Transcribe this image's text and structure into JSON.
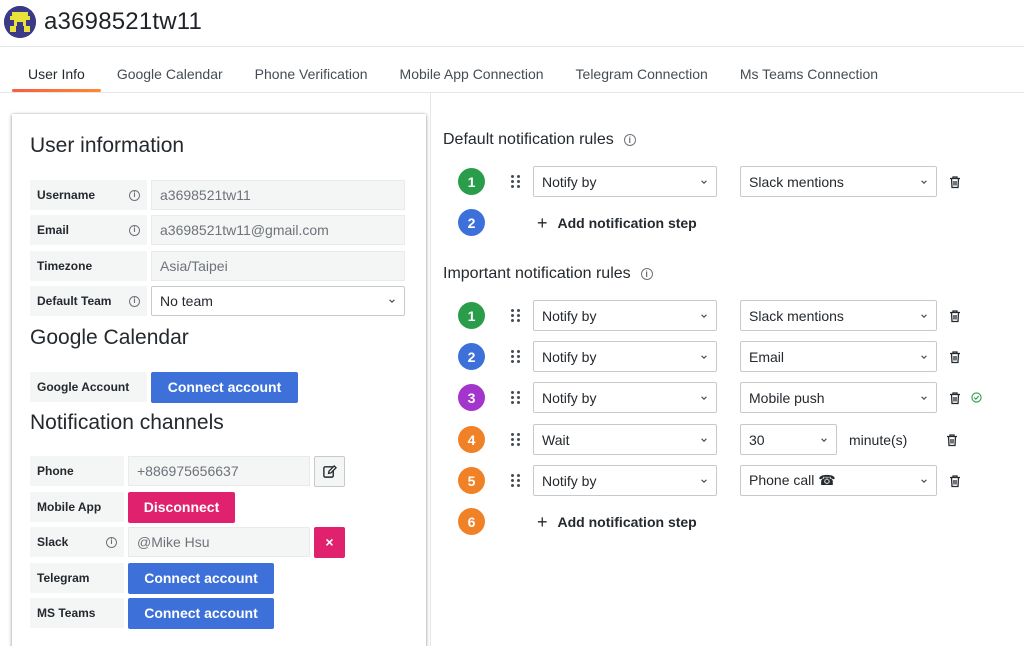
{
  "header": {
    "title": "a3698521tw11",
    "avatar_icon": "pixel-avatar-icon"
  },
  "tabs": [
    {
      "label": "User Info",
      "active": true
    },
    {
      "label": "Google Calendar",
      "active": false
    },
    {
      "label": "Phone Verification",
      "active": false
    },
    {
      "label": "Mobile App Connection",
      "active": false
    },
    {
      "label": "Telegram Connection",
      "active": false
    },
    {
      "label": "Ms Teams Connection",
      "active": false
    }
  ],
  "user_info": {
    "title": "User information",
    "username_label": "Username",
    "username_value": "a3698521tw11",
    "email_label": "Email",
    "email_value": "a3698521tw11@gmail.com",
    "timezone_label": "Timezone",
    "timezone_value": "Asia/Taipei",
    "team_label": "Default Team",
    "team_value": "No team"
  },
  "google_calendar": {
    "title": "Google Calendar",
    "account_label": "Google Account",
    "connect_label": "Connect account"
  },
  "channels": {
    "title": "Notification channels",
    "phone_label": "Phone",
    "phone_value": "+886975656637",
    "mobile_label": "Mobile App",
    "mobile_button": "Disconnect",
    "slack_label": "Slack",
    "slack_value": "@Mike Hsu",
    "slack_remove": "×",
    "telegram_label": "Telegram",
    "telegram_button": "Connect account",
    "teams_label": "MS Teams",
    "teams_button": "Connect account"
  },
  "default_rules": {
    "title": "Default notification rules",
    "steps": [
      {
        "num": "1",
        "color": "#2a9d4a",
        "action": "Notify by",
        "target": "Slack mentions"
      },
      {
        "num": "2",
        "color": "#3d71d9",
        "add_label": "Add notification step"
      }
    ]
  },
  "important_rules": {
    "title": "Important notification rules",
    "steps": [
      {
        "num": "1",
        "color": "#2a9d4a",
        "action": "Notify by",
        "target": "Slack mentions"
      },
      {
        "num": "2",
        "color": "#3d71d9",
        "action": "Notify by",
        "target": "Email"
      },
      {
        "num": "3",
        "color": "#a334cc",
        "action": "Notify by",
        "target": "Mobile push"
      },
      {
        "num": "4",
        "color": "#f08127",
        "action": "Wait",
        "target": "30",
        "unit": "minute(s)"
      },
      {
        "num": "5",
        "color": "#f08127",
        "action": "Notify by",
        "target": "Phone call ☎"
      },
      {
        "num": "6",
        "color": "#f08127",
        "add_label": "Add notification step"
      }
    ]
  },
  "colors": {
    "accent_blue": "#3d71d9",
    "accent_pink": "#e0226e",
    "tab_underline": "#f55f3e",
    "check_green": "#2a9d4a"
  }
}
